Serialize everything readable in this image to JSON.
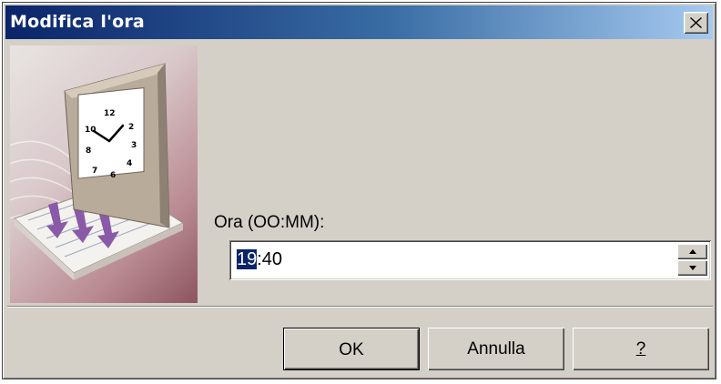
{
  "dialog": {
    "title": "Modifica l'ora",
    "close_label": "×"
  },
  "form": {
    "label": "Ora (OO:MM):",
    "time_selected": "19",
    "time_rest": ":40"
  },
  "buttons": {
    "ok": "OK",
    "cancel": "Annulla",
    "help": "?"
  },
  "illustration": {
    "icon": "clock-calendar-illustration"
  },
  "colors": {
    "titlebar_start": "#0a246a",
    "titlebar_end": "#a6caf0",
    "dialog_bg": "#d4d0c8",
    "selection": "#0a246a"
  }
}
